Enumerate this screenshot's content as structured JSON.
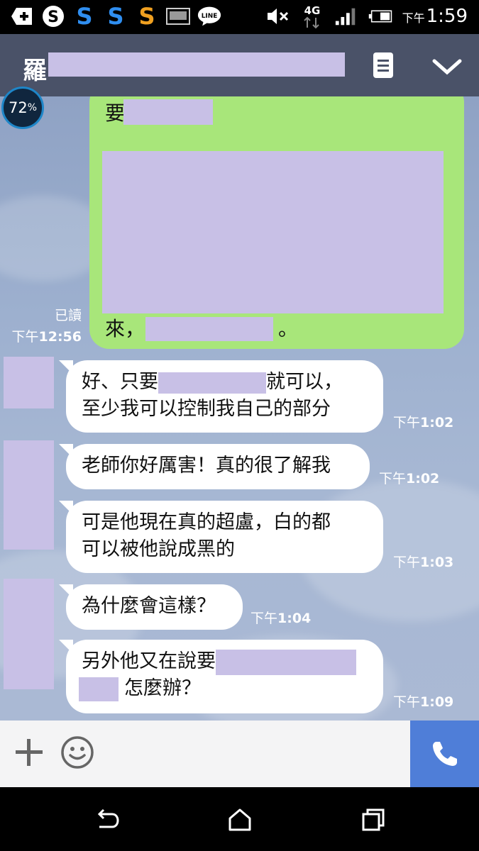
{
  "status_bar": {
    "time_ampm": "下午",
    "time": "1:59",
    "network": "4G",
    "notification_icons": [
      "add-box-icon",
      "skype-icon",
      "s-app-blue-icon",
      "s-app-blue-icon",
      "s-app-orange-icon",
      "image-icon",
      "line-icon"
    ]
  },
  "header": {
    "title_char": "羅"
  },
  "badge": {
    "value": "72",
    "unit": "%"
  },
  "sent_message": {
    "line1_prefix": "要",
    "line3_prefix": "來，",
    "line3_suffix": "。",
    "read_label": "已讀",
    "time_ampm": "下午",
    "time": "12:56"
  },
  "messages": [
    {
      "line1a": "好、只要",
      "line1b": "就可以，",
      "line2": "至少我可以控制我自己的部分",
      "ampm": "下午",
      "time": "1:02"
    },
    {
      "text": "老師你好厲害！真的很了解我",
      "ampm": "下午",
      "time": "1:02"
    },
    {
      "line1": "可是他現在真的超盧，白的都",
      "line2": "可以被他說成黑的",
      "ampm": "下午",
      "time": "1:03"
    },
    {
      "text": "為什麼會這樣？",
      "ampm": "下午",
      "time": "1:04"
    },
    {
      "line1": "另外他又在說要",
      "line2": "怎麼辦？",
      "ampm": "下午",
      "time": "1:09"
    }
  ],
  "colors": {
    "header_bg": "#4a5268",
    "sent_bubble": "#a8e67a",
    "call_button": "#4f7ed8",
    "redaction": "#c8c0e6"
  }
}
